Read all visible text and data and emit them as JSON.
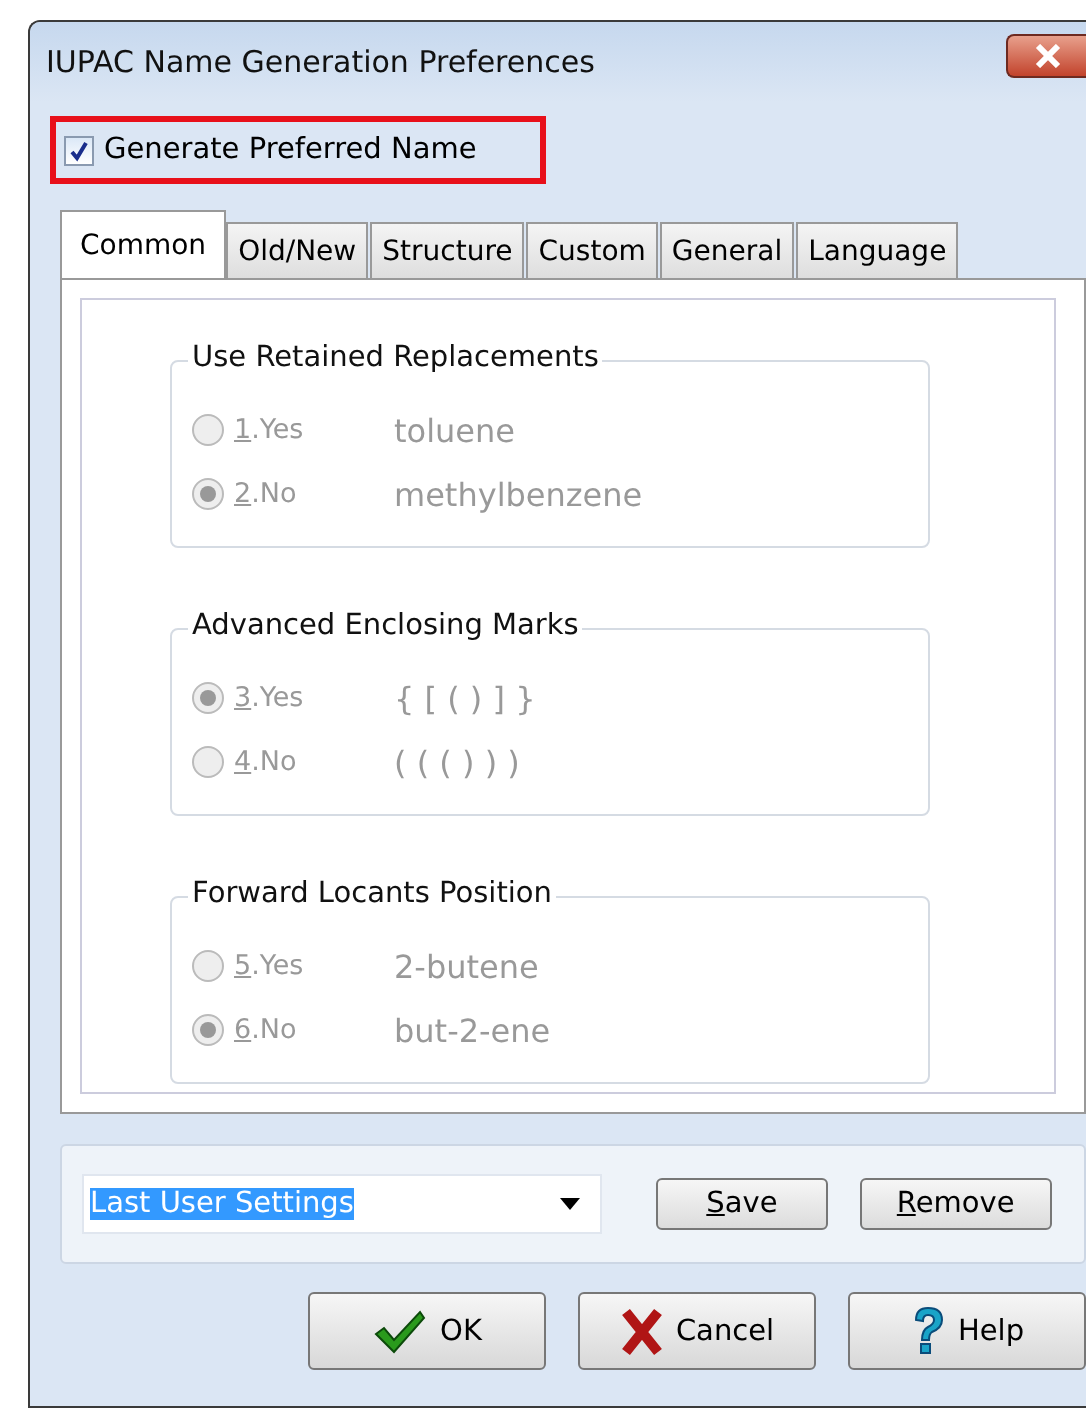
{
  "window": {
    "title": "IUPAC Name Generation Preferences"
  },
  "preferred": {
    "label": "Generate Preferred Name",
    "checked": true,
    "highlighted": true
  },
  "tabs": [
    {
      "label": "Common",
      "selected": true
    },
    {
      "label": "Old/New",
      "selected": false
    },
    {
      "label": "Structure",
      "selected": false
    },
    {
      "label": "Custom",
      "selected": false
    },
    {
      "label": "General",
      "selected": false
    },
    {
      "label": "Language",
      "selected": false
    }
  ],
  "groups": [
    {
      "title": "Use Retained Replacements",
      "disabled": true,
      "options": [
        {
          "key": "1",
          "rest": ".Yes",
          "example": "toluene",
          "selected": false
        },
        {
          "key": "2",
          "rest": ".No",
          "example": "methylbenzene",
          "selected": true
        }
      ]
    },
    {
      "title": "Advanced Enclosing Marks",
      "disabled": true,
      "options": [
        {
          "key": "3",
          "rest": ".Yes",
          "example": "{ [ ( ) ] }",
          "selected": true
        },
        {
          "key": "4",
          "rest": ".No",
          "example": "( ( ( ) ) )",
          "selected": false
        }
      ]
    },
    {
      "title": "Forward Locants Position",
      "disabled": true,
      "options": [
        {
          "key": "5",
          "rest": ".Yes",
          "example": "2-butene",
          "selected": false
        },
        {
          "key": "6",
          "rest": ".No",
          "example": "but-2-ene",
          "selected": true
        }
      ]
    }
  ],
  "settings": {
    "value": "Last User Settings",
    "buttons": [
      {
        "key": "S",
        "rest": "ave"
      },
      {
        "key": "R",
        "rest": "emove"
      }
    ]
  },
  "buttons": [
    {
      "kind": "ok",
      "label": "OK"
    },
    {
      "kind": "cancel",
      "label": "Cancel"
    },
    {
      "kind": "help",
      "label": "Help"
    }
  ]
}
